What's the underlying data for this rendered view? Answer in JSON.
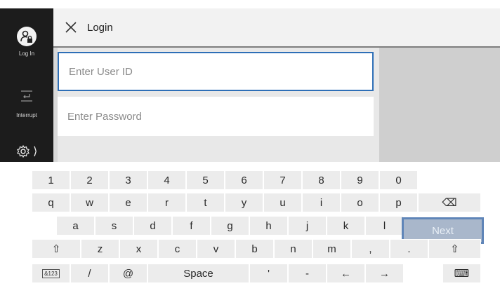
{
  "sidebar": {
    "login_label": "Log In",
    "interrupt_label": "Interrupt",
    "expand_glyph": "⟩"
  },
  "header": {
    "title": "Login"
  },
  "form": {
    "user_id_placeholder": "Enter User ID",
    "password_placeholder": "Enter Password"
  },
  "keyboard": {
    "row1": [
      "1",
      "2",
      "3",
      "4",
      "5",
      "6",
      "7",
      "8",
      "9",
      "0"
    ],
    "row2": [
      "q",
      "w",
      "e",
      "r",
      "t",
      "y",
      "u",
      "i",
      "o",
      "p"
    ],
    "row3": [
      "a",
      "s",
      "d",
      "f",
      "g",
      "h",
      "j",
      "k",
      "l"
    ],
    "row4": [
      "z",
      "x",
      "c",
      "v",
      "b",
      "n",
      "m",
      ",",
      "."
    ],
    "backspace_glyph": "⌫",
    "shift_glyph": "⇧",
    "next_label": "Next",
    "symbols_label": "&123",
    "slash": "/",
    "at": "@",
    "space_label": "Space",
    "apostrophe": "'",
    "dash": "-",
    "left_arrow": "←",
    "right_arrow": "→",
    "keyboard_icon": "⌨"
  },
  "colors": {
    "accent": "#2e6fb7",
    "rail": "#1c1c1c",
    "key": "#ececec",
    "next_bg": "#a9b7cb"
  }
}
